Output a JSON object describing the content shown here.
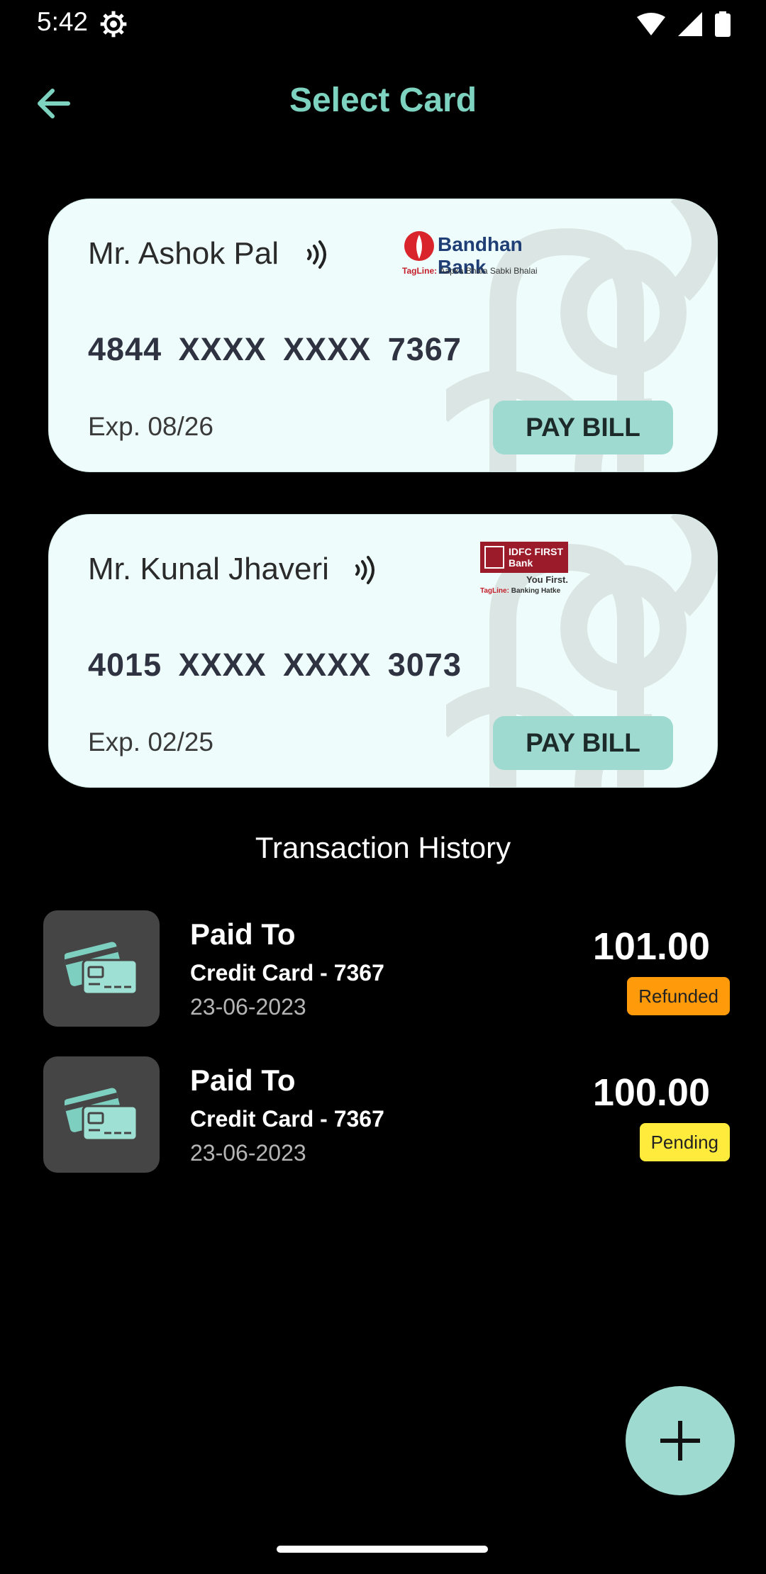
{
  "status_bar": {
    "time": "5:42"
  },
  "header": {
    "title": "Select Card"
  },
  "cards": [
    {
      "holder": "Mr. Ashok Pal",
      "number": "4844  XXXX  XXXX  7367",
      "expiry": "Exp. 08/26",
      "pay_label": "PAY BILL",
      "bank": {
        "name": "Bandhan Bank",
        "tag_label": "TagLine:",
        "tagline": "Aapka Bhala Sabki Bhalai"
      }
    },
    {
      "holder": "Mr. Kunal Jhaveri",
      "number": "4015  XXXX  XXXX  3073",
      "expiry": "Exp. 02/25",
      "pay_label": "PAY BILL",
      "bank": {
        "name": "IDFC FIRST Bank",
        "slogan": "You First.",
        "tag_label": "TagLine:",
        "tagline": "Banking Hatke"
      }
    }
  ],
  "transaction_history": {
    "title": "Transaction History",
    "items": [
      {
        "title": "Paid To",
        "subtitle": "Credit Card - 7367",
        "date": "23-06-2023",
        "amount": "101.00",
        "status": "Refunded",
        "status_color": "#ff9a0a"
      },
      {
        "title": "Paid To",
        "subtitle": "Credit Card - 7367",
        "date": "23-06-2023",
        "amount": "100.00",
        "status": "Pending",
        "status_color": "#ffeb3b"
      }
    ]
  },
  "colors": {
    "accent": "#9fdad1",
    "title": "#7dd3c0",
    "card_bg": "#eefdfb"
  }
}
